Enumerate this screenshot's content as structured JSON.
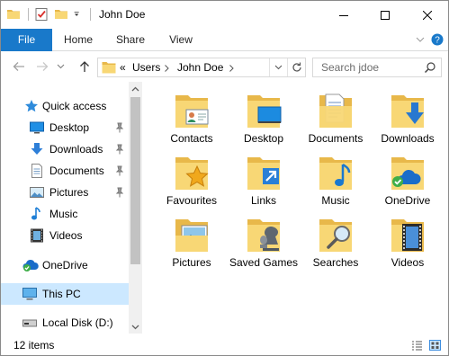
{
  "window": {
    "title": "John Doe"
  },
  "ribbon": {
    "tabs": [
      "File",
      "Home",
      "Share",
      "View"
    ]
  },
  "address": {
    "chevron": "«",
    "crumbs": [
      "Users",
      "John Doe"
    ]
  },
  "search": {
    "placeholder": "Search jdoe"
  },
  "nav": {
    "quick_access": "Quick access",
    "items": [
      {
        "label": "Desktop",
        "icon": "desktop-icon",
        "pinned": true
      },
      {
        "label": "Downloads",
        "icon": "downloads-icon",
        "pinned": true
      },
      {
        "label": "Documents",
        "icon": "documents-icon",
        "pinned": true
      },
      {
        "label": "Pictures",
        "icon": "pictures-icon",
        "pinned": true
      },
      {
        "label": "Music",
        "icon": "music-icon",
        "pinned": false
      },
      {
        "label": "Videos",
        "icon": "videos-icon",
        "pinned": false
      }
    ],
    "onedrive": "OneDrive",
    "this_pc": "This PC",
    "local_disk": "Local Disk (D:)"
  },
  "folders": [
    {
      "label": "Contacts",
      "icon": "contacts-folder-icon"
    },
    {
      "label": "Desktop",
      "icon": "desktop-folder-icon"
    },
    {
      "label": "Documents",
      "icon": "documents-folder-icon"
    },
    {
      "label": "Downloads",
      "icon": "downloads-folder-icon"
    },
    {
      "label": "Favourites",
      "icon": "favourites-folder-icon"
    },
    {
      "label": "Links",
      "icon": "links-folder-icon"
    },
    {
      "label": "Music",
      "icon": "music-folder-icon"
    },
    {
      "label": "OneDrive",
      "icon": "onedrive-folder-icon"
    },
    {
      "label": "Pictures",
      "icon": "pictures-folder-icon"
    },
    {
      "label": "Saved Games",
      "icon": "saved-games-folder-icon"
    },
    {
      "label": "Searches",
      "icon": "searches-folder-icon"
    },
    {
      "label": "Videos",
      "icon": "videos-folder-icon"
    }
  ],
  "status": {
    "item_count": "12 items"
  },
  "colors": {
    "accent": "#1979ca",
    "folder": "#f8d775",
    "folder_dark": "#e8b84a",
    "selected": "#cce8ff"
  }
}
